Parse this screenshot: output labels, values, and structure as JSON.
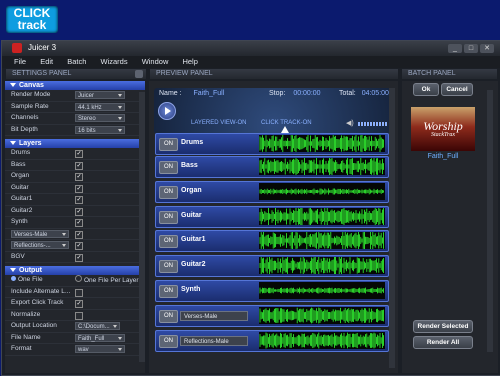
{
  "logo": {
    "line1": "CLICK",
    "line2": "track"
  },
  "window": {
    "title": "Juicer 3",
    "buttons": [
      "_",
      "□",
      "✕"
    ]
  },
  "menu": [
    "File",
    "Edit",
    "Batch",
    "Wizards",
    "Window",
    "Help"
  ],
  "panels": {
    "settings": "SETTINGS PANEL",
    "preview": "PREVIEW PANEL",
    "batch": "BATCH PANEL"
  },
  "canvas": {
    "title": "Canvas",
    "rows": [
      {
        "label": "Render Mode",
        "value": "Juicer"
      },
      {
        "label": "Sample Rate",
        "value": "44.1 kHz"
      },
      {
        "label": "Channels",
        "value": "Stereo"
      },
      {
        "label": "Bit Depth",
        "value": "16 bits"
      }
    ]
  },
  "layers": {
    "title": "Layers",
    "items": [
      "Drums",
      "Bass",
      "Organ",
      "Guitar",
      "Guitar1",
      "Guitar2",
      "Synth"
    ],
    "selects": [
      "Verses-Male",
      "Reflections-..."
    ],
    "last": "BGV"
  },
  "output": {
    "title": "Output",
    "one_file": "One File",
    "one_file_per_layer": "One File Per Layer",
    "include_alternate": "Include Alternate L...",
    "export_click": "Export Click Track",
    "normalize": "Normalize",
    "output_location_label": "Output Location",
    "output_location_value": "C:\\Docum...",
    "file_name_label": "File Name",
    "file_name_value": "Faith_Full",
    "format_label": "Format",
    "format_value": "wav"
  },
  "preview": {
    "name_label": "Name :",
    "name_value": "Faith_Full",
    "stop_label": "Stop:",
    "stop_value": "00:00:00",
    "total_label": "Total:",
    "total_value": "04:05:00",
    "layered_view": "LAYERED VIEW-ON",
    "click_track": "CLICK TRACK-ON",
    "on_label": "ON",
    "tracks": [
      "Drums",
      "Bass",
      "Organ",
      "Guitar",
      "Guitar1",
      "Guitar2",
      "Synth",
      "Verses-Male",
      "Reflections-Male"
    ]
  },
  "batch": {
    "ok": "Ok",
    "cancel": "Cancel",
    "album_title": "Worship",
    "album_subtitle": "StackTrax",
    "song": "Faith_Full",
    "render_selected": "Render Selected",
    "render_all": "Render All"
  },
  "colors": {
    "accent": "#3b5bd6",
    "wave": "#33ff33",
    "bg": "#0b1a6e"
  }
}
